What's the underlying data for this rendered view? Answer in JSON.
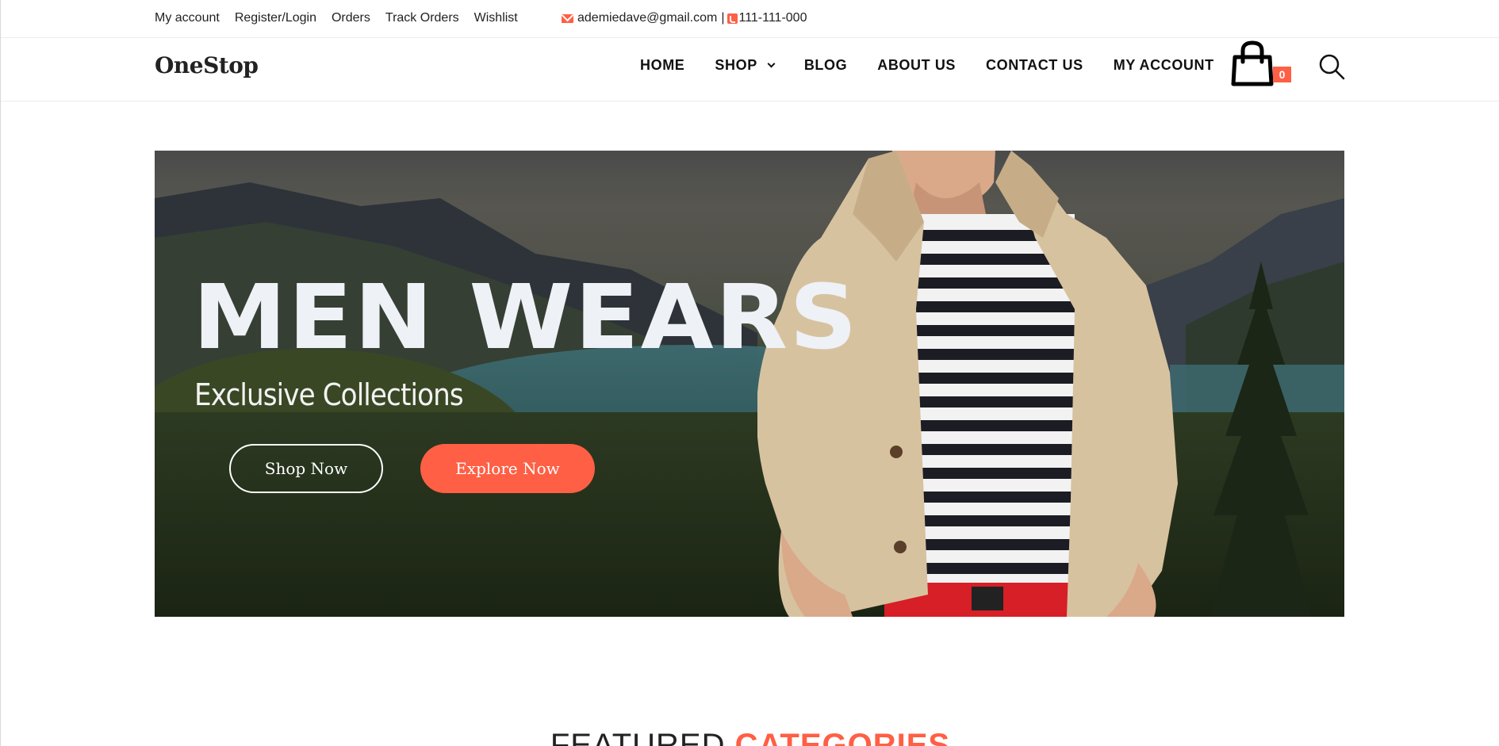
{
  "topbar": {
    "links": [
      "My account",
      "Register/Login",
      "Orders",
      "Track Orders",
      "Wishlist"
    ],
    "email": "ademiedave@gmail.com",
    "separator": "|",
    "phone": "111-111-000"
  },
  "header": {
    "logo": "OneStop",
    "nav": {
      "home": "HOME",
      "shop": "SHOP",
      "blog": "BLOG",
      "about": "ABOUT US",
      "contact": "CONTACT US",
      "account": "MY ACCOUNT"
    },
    "cart_count": "0"
  },
  "hero": {
    "title": "MEN WEARS",
    "subtitle": "Exclusive Collections",
    "shop_button": "Shop Now",
    "explore_button": "Explore Now"
  },
  "featured": {
    "word1": "FEATURED",
    "word2": "CATEGORIES"
  },
  "colors": {
    "accent": "#ff5f45",
    "text": "#222222"
  },
  "icons": [
    "mail-icon",
    "phone-icon",
    "chevron-down-icon",
    "shopping-bag-icon",
    "search-icon"
  ]
}
